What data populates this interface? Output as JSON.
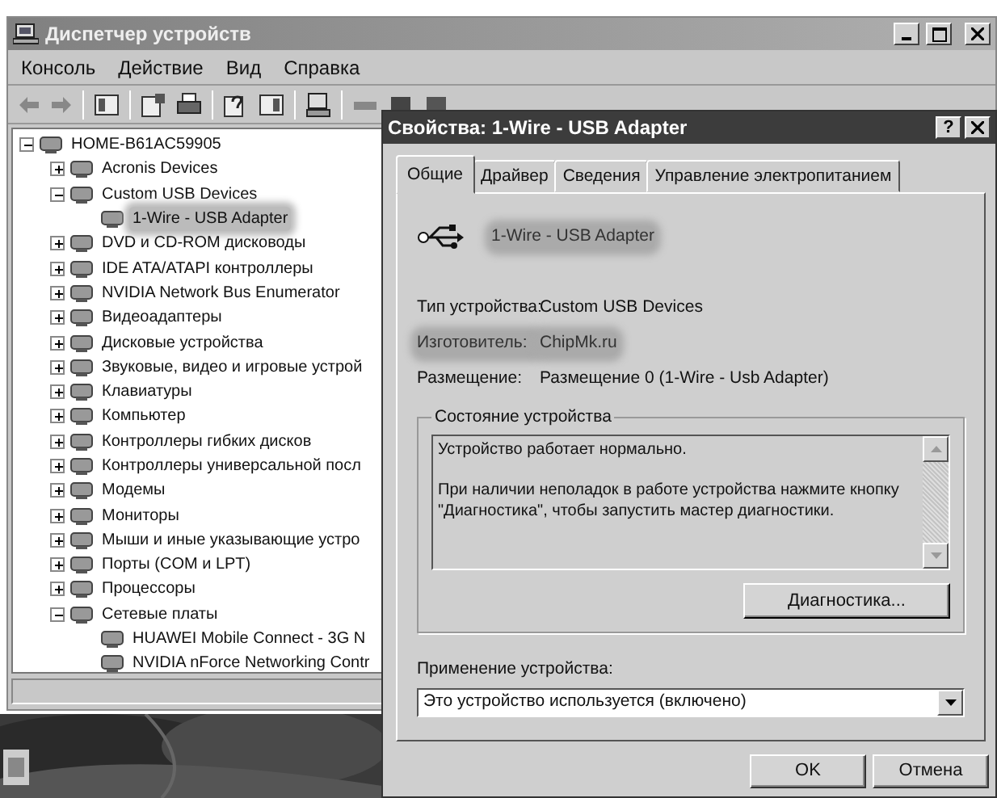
{
  "main_window": {
    "title": "Диспетчер устройств",
    "menu": [
      "Консоль",
      "Действие",
      "Вид",
      "Справка"
    ],
    "tree": [
      {
        "label": "HOME-B61AC59905",
        "expanded": true,
        "selected": false,
        "children": [
          {
            "label": "Acronis Devices",
            "expanded": false,
            "selected": false
          },
          {
            "label": "Custom USB Devices",
            "expanded": true,
            "selected": false,
            "children": [
              {
                "label": "1-Wire - USB Adapter",
                "selected": true
              }
            ]
          },
          {
            "label": "DVD и CD-ROM дисководы",
            "expanded": false,
            "selected": false
          },
          {
            "label": "IDE ATA/ATAPI контроллеры",
            "expanded": false,
            "selected": false
          },
          {
            "label": "NVIDIA Network Bus Enumerator",
            "expanded": false,
            "selected": false
          },
          {
            "label": "Видеоадаптеры",
            "expanded": false,
            "selected": false
          },
          {
            "label": "Дисковые устройства",
            "expanded": false,
            "selected": false
          },
          {
            "label": "Звуковые, видео и игровые устрой",
            "expanded": false,
            "selected": false
          },
          {
            "label": "Клавиатуры",
            "expanded": false,
            "selected": false
          },
          {
            "label": "Компьютер",
            "expanded": false,
            "selected": false
          },
          {
            "label": "Контроллеры гибких дисков",
            "expanded": false,
            "selected": false
          },
          {
            "label": "Контроллеры универсальной посл",
            "expanded": false,
            "selected": false
          },
          {
            "label": "Модемы",
            "expanded": false,
            "selected": false
          },
          {
            "label": "Мониторы",
            "expanded": false,
            "selected": false
          },
          {
            "label": "Мыши и иные указывающие устро",
            "expanded": false,
            "selected": false
          },
          {
            "label": "Порты (COM и LPT)",
            "expanded": false,
            "selected": false
          },
          {
            "label": "Процессоры",
            "expanded": false,
            "selected": false
          },
          {
            "label": "Сетевые платы",
            "expanded": true,
            "selected": false,
            "children": [
              {
                "label": "HUAWEI Mobile Connect - 3G N",
                "selected": false
              },
              {
                "label": "NVIDIA nForce Networking Contr",
                "selected": false
              }
            ]
          }
        ]
      }
    ]
  },
  "dialog": {
    "title": "Свойства: 1-Wire - USB Adapter",
    "help_button": "?",
    "tabs": [
      {
        "label": "Общие",
        "selected": true
      },
      {
        "label": "Драйвер",
        "selected": false
      },
      {
        "label": "Сведения",
        "selected": false
      },
      {
        "label": "Управление электропитанием",
        "selected": false
      }
    ],
    "device_name": {
      "text": "1-Wire - USB Adapter",
      "highlighted": true
    },
    "properties": [
      {
        "label": "Тип устройства:",
        "value": "Custom USB Devices",
        "highlighted": false
      },
      {
        "label": "Изготовитель:",
        "value": "ChipMk.ru",
        "highlighted": true
      },
      {
        "label": "Размещение:",
        "value": "Размещение 0 (1-Wire - Usb Adapter)",
        "highlighted": false
      }
    ],
    "status_group": {
      "title": "Состояние устройства",
      "paragraphs": [
        "Устройство работает нормально.",
        "При наличии неполадок в работе устройства нажмите кнопку \"Диагностика\", чтобы запустить мастер диагностики."
      ],
      "button": "Диагностика..."
    },
    "usage": {
      "label": "Применение устройства:",
      "value": "Это устройство используется (включено)"
    },
    "buttons": [
      "OK",
      "Отмена"
    ]
  }
}
